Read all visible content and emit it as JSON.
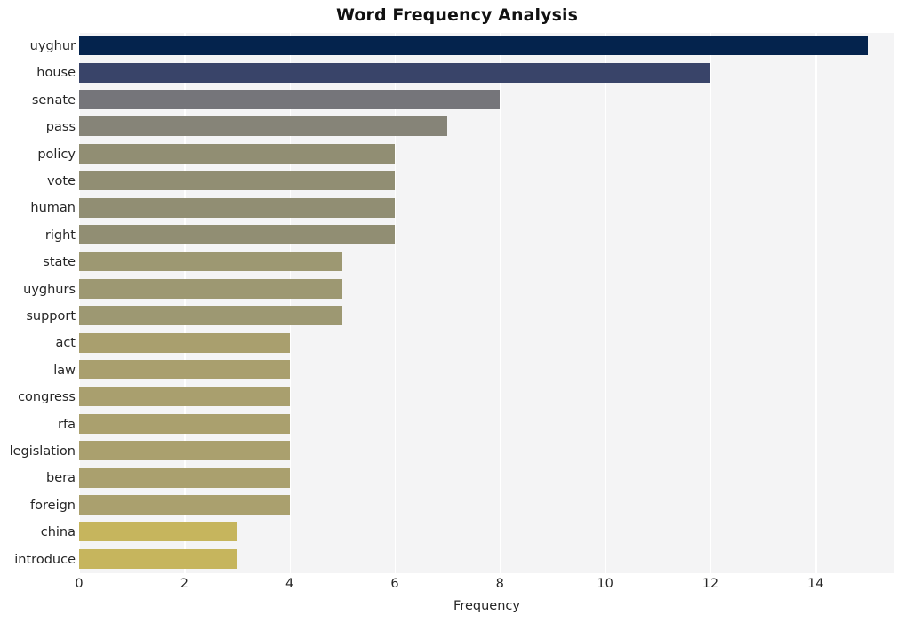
{
  "chart_data": {
    "type": "bar",
    "orientation": "horizontal",
    "title": "Word Frequency Analysis",
    "xlabel": "Frequency",
    "ylabel": "",
    "xlim": [
      0,
      15.5
    ],
    "xticks": [
      0,
      2,
      4,
      6,
      8,
      10,
      12,
      14
    ],
    "grid": true,
    "legend": "none",
    "categories": [
      "uyghur",
      "house",
      "senate",
      "pass",
      "policy",
      "vote",
      "human",
      "right",
      "state",
      "uyghurs",
      "support",
      "act",
      "law",
      "congress",
      "rfa",
      "legislation",
      "bera",
      "foreign",
      "china",
      "introduce"
    ],
    "values": [
      15,
      12,
      8,
      7,
      6,
      6,
      6,
      6,
      5,
      5,
      5,
      4,
      4,
      4,
      4,
      4,
      4,
      4,
      3,
      3
    ],
    "bar_colors": [
      "#04234d",
      "#394469",
      "#75757a",
      "#868478",
      "#918e73",
      "#918e73",
      "#918e73",
      "#918e73",
      "#9d9872",
      "#9d9872",
      "#9d9872",
      "#a99f6e",
      "#a99f6e",
      "#a99f6e",
      "#aaa06e",
      "#aaa06e",
      "#aaa06e",
      "#aaa06e",
      "#c6b55d",
      "#c6b55d"
    ],
    "plot_background": "#f4f4f5",
    "gridline_color": "#ffffff",
    "figure_background": "#ffffff"
  }
}
